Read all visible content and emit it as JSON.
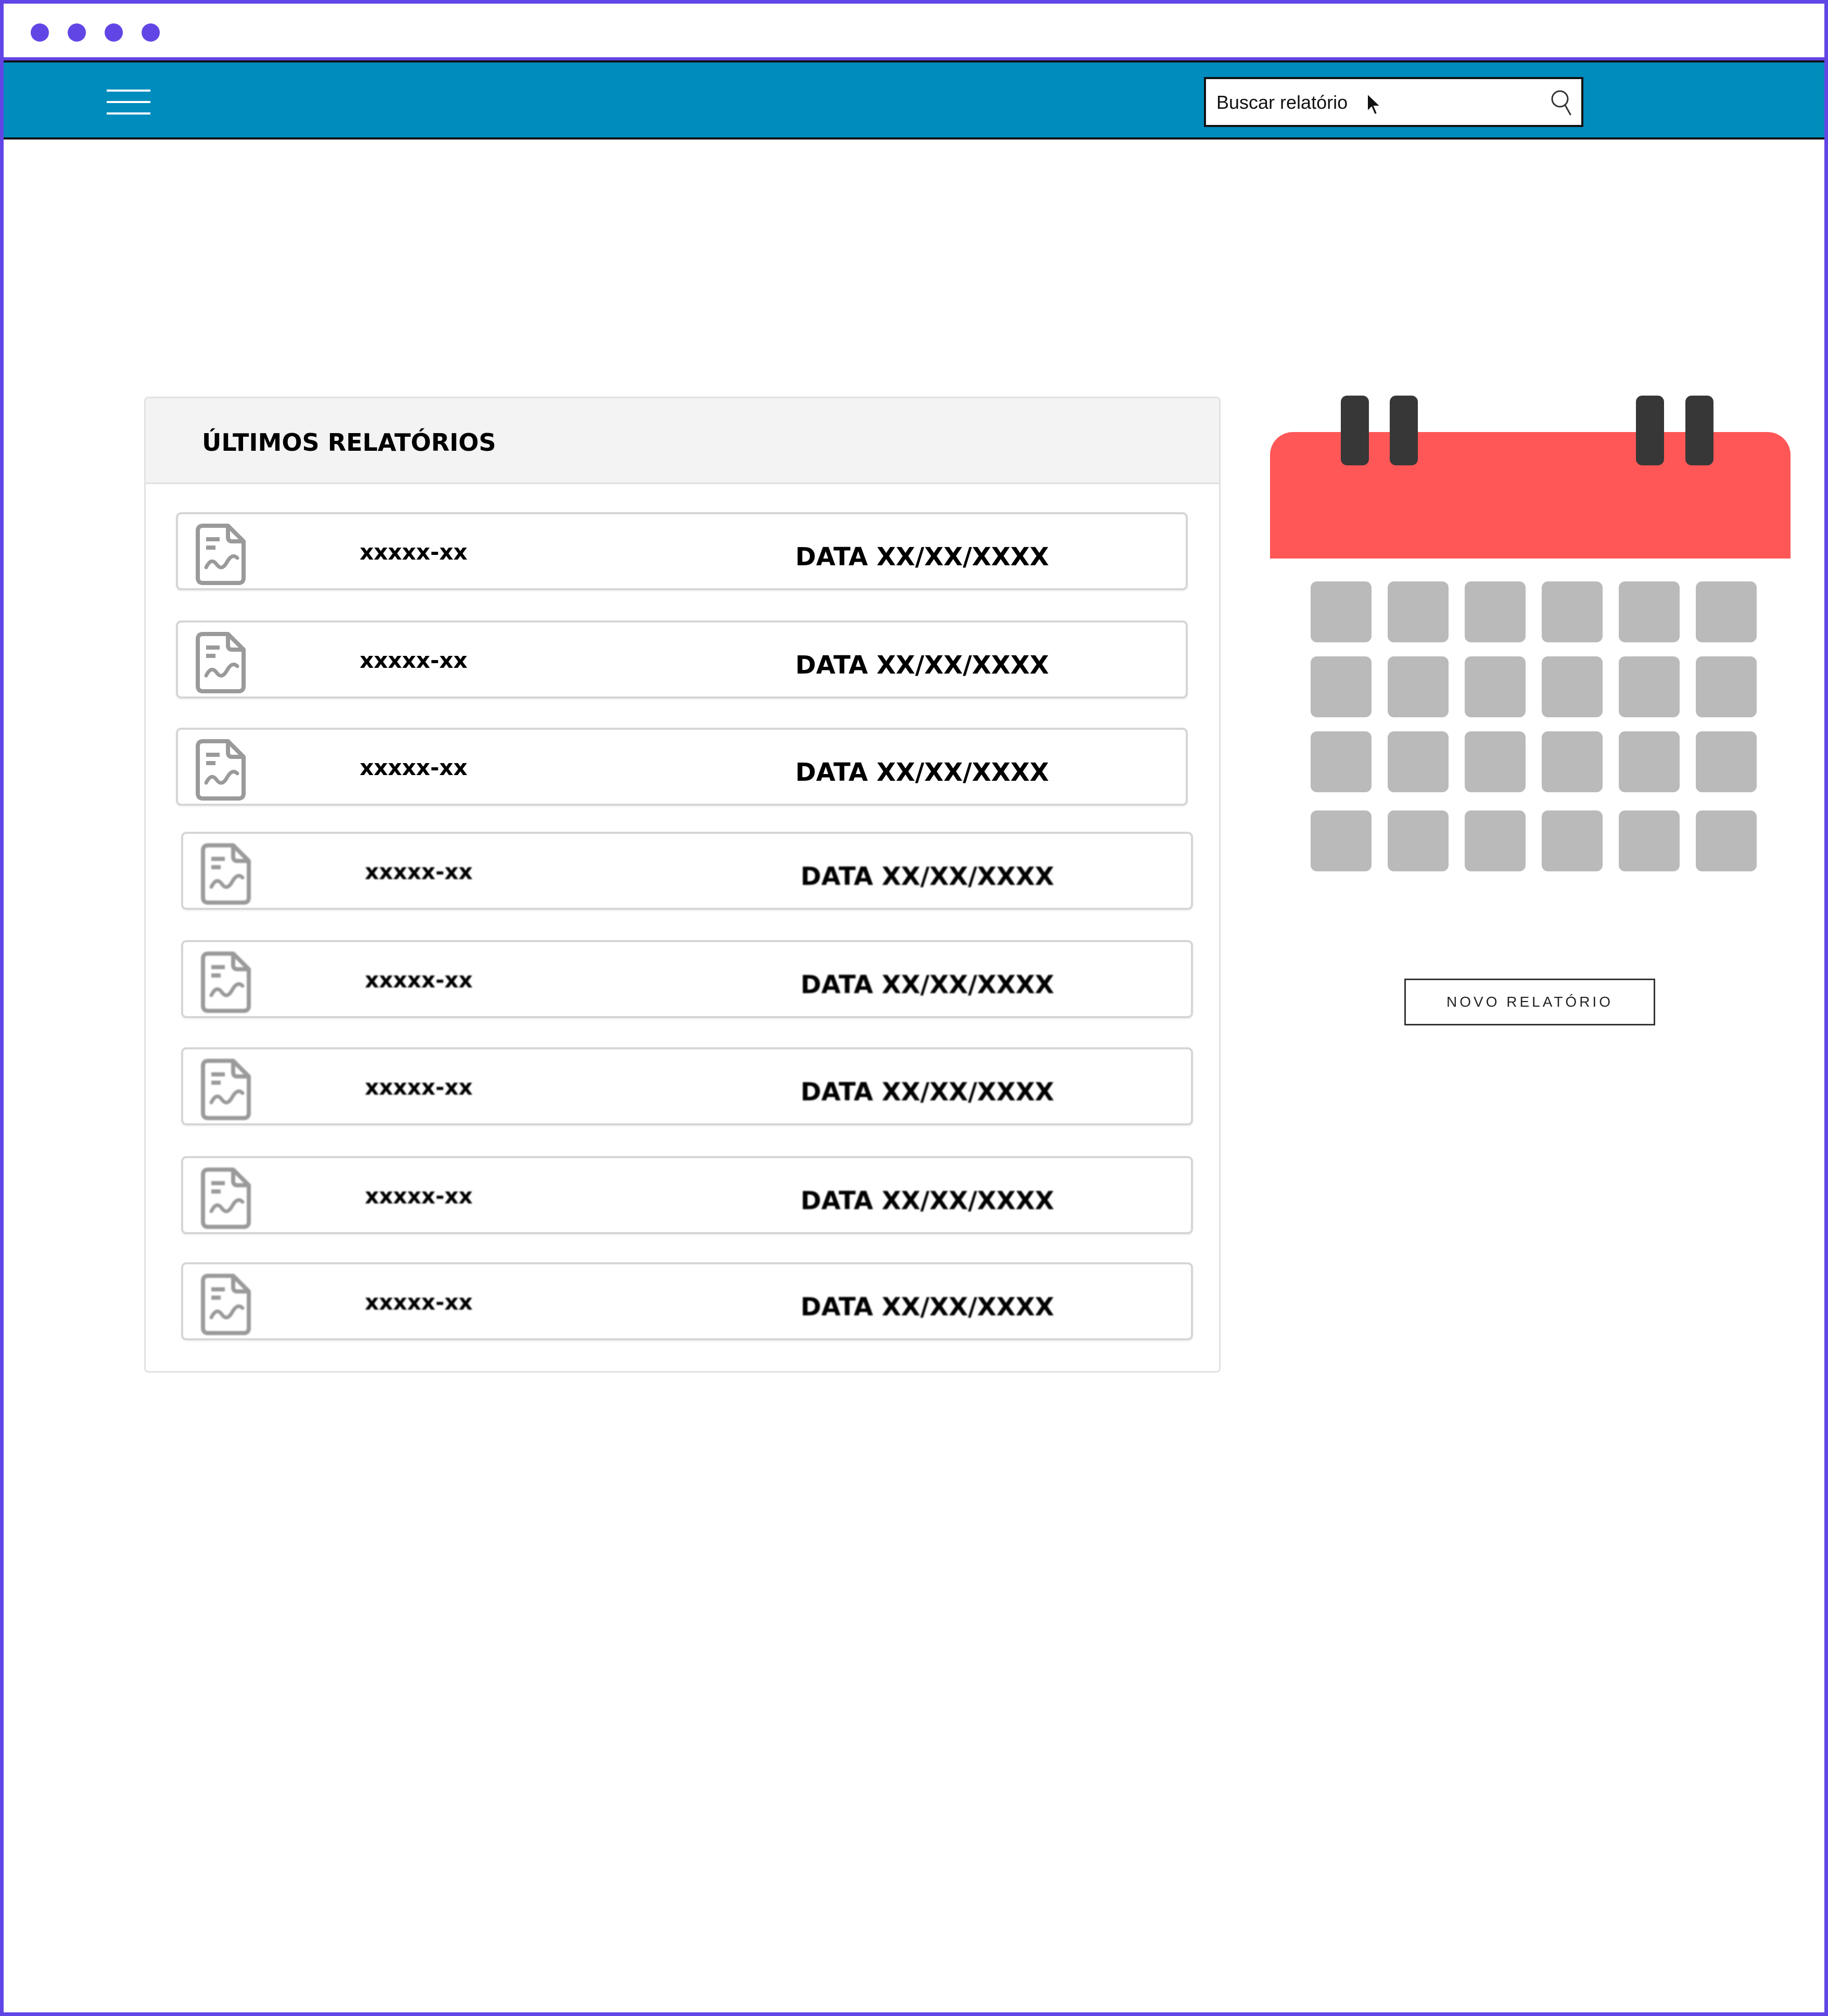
{
  "search": {
    "placeholder": "Buscar relatório"
  },
  "panel": {
    "title": "ÚLTIMOS RELATÓRIOS",
    "reports": [
      {
        "code": "xxxxx-xx",
        "date": "DATA XX/XX/XXXX"
      },
      {
        "code": "xxxxx-xx",
        "date": "DATA XX/XX/XXXX"
      },
      {
        "code": "xxxxx-xx",
        "date": "DATA XX/XX/XXXX"
      },
      {
        "code": "xxxxx-xx",
        "date": "DATA XX/XX/XXXX"
      },
      {
        "code": "xxxxx-xx",
        "date": "DATA XX/XX/XXXX"
      },
      {
        "code": "xxxxx-xx",
        "date": "DATA XX/XX/XXXX"
      },
      {
        "code": "xxxxx-xx",
        "date": "DATA XX/XX/XXXX"
      },
      {
        "code": "xxxxx-xx",
        "date": "DATA XX/XX/XXXX"
      }
    ]
  },
  "actions": {
    "new_report": "NOVO RELATÓRIO"
  },
  "icons": {
    "menu": "hamburger-menu-icon",
    "search": "search-icon",
    "cursor": "mouse-cursor-icon",
    "report": "document-chart-icon",
    "calendar": "calendar-icon"
  },
  "colors": {
    "window_frame": "#6246e5",
    "topbar": "#008cbd",
    "calendar_header": "#ff5757",
    "calendar_rings": "#373737",
    "calendar_cells": "#bababa"
  }
}
